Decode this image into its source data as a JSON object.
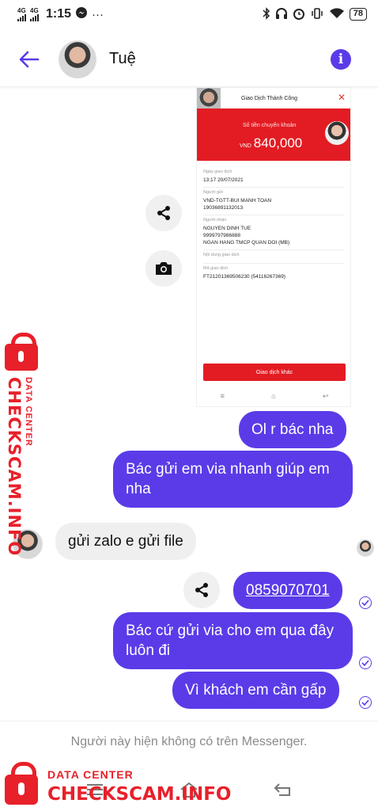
{
  "status_bar": {
    "signal_1": "4G",
    "signal_2": "4G",
    "time": "1:15",
    "notification_icon": "messenger-icon",
    "more": "···",
    "right_icons": [
      "bluetooth-icon",
      "headphones-icon",
      "alarm-icon",
      "vibrate-icon",
      "wifi-icon"
    ],
    "battery": "78"
  },
  "header": {
    "contact_name": "Tuệ",
    "back_icon": "arrow-left-icon",
    "info_icon": "info-icon"
  },
  "receipt": {
    "title": "Giao Dịch Thành Công",
    "close": "✕",
    "amount_label": "Số tiền chuyển khoản",
    "currency": "VND",
    "amount": "840,000",
    "fields": [
      {
        "label": "Ngày giao dịch",
        "value": "13:17 20/07/2021"
      },
      {
        "label": "Người gửi",
        "value": "VND-TGTT-BUI MANH TOAN\n19036891132013"
      },
      {
        "label": "Người nhận",
        "value": "NGUYEN DINH TUE\n9999797986888\nNGAN HANG TMCP QUAN DOI (MB)"
      },
      {
        "label": "Nội dung giao dịch",
        "value": ""
      },
      {
        "label": "Mã giao dịch",
        "value": "FT21201369506230 (54116267369)"
      }
    ],
    "button": "Giao dịch khác",
    "nav": [
      "≡",
      "⌂",
      "↩"
    ]
  },
  "messages": {
    "m1": "Ol r bác nha",
    "m2": "Bác gửi em via nhanh giúp em nha",
    "m3": "gửi zalo e gửi file",
    "m4": "0859070701",
    "m5": "Bác cứ gửi via cho em qua đây luôn đi",
    "m6": "Vì khách em cần gấp"
  },
  "footer": {
    "unavailable": "Người này hiện không có trên Messenger."
  },
  "watermark": {
    "sub": "DATA CENTER",
    "main": "CHECKSCAM.INFO",
    "color": "#e8202a"
  },
  "colors": {
    "accent": "#5b3be8",
    "incoming": "#efefef"
  }
}
